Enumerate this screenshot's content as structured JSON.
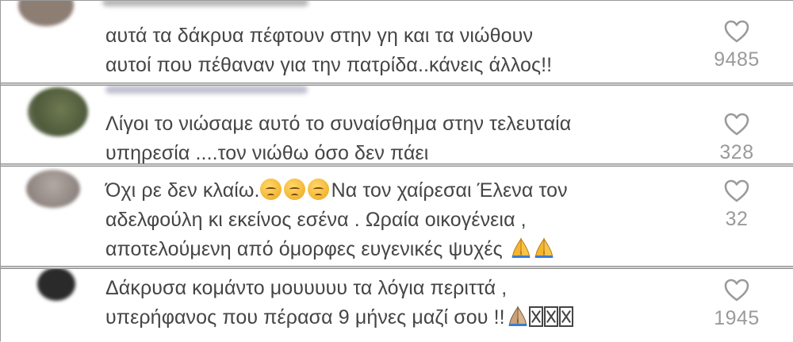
{
  "comments": [
    {
      "lines": [
        "αυτά τα δάκρυα πέφτουν στην γη και τα νιώθουν",
        "αυτοί που πέθαναν για την πατρίδα..κάνεις άλλος!!"
      ],
      "likes": "9485"
    },
    {
      "lines": [
        "Λίγοι το νιώσαμε αυτό το συναίσθημα στην τελευταία",
        "υπηρεσία ....τον νιώθω όσο δεν πάει"
      ],
      "likes": "328"
    },
    {
      "line1_start": "Όχι ρε δεν κλαίω.",
      "line1_end": "Να τον χαίρεσαι Έλενα τον",
      "emoji_1": "pensive-face",
      "lines_rest": [
        "αδελφούλη κι εκείνος εσένα . Ωραία οικογένεια ,",
        "αποτελούμενη από όμορφες ευγενικές ψυχές "
      ],
      "emoji_2": "folded-hands",
      "likes": "32"
    },
    {
      "line1": "Δάκρυσα κομάντο μουυυυυ τα λόγια περιττά ,",
      "line2": "υπερήφανος που πέρασα 9 μήνες μαζί σου !!",
      "emoji_3": "folded-hands",
      "missing_glyphs": "missing-glyph-boxes",
      "likes": "1945"
    }
  ],
  "colors": {
    "text": "#454545",
    "count": "#9a9a9a",
    "heart": "#9a9a9a",
    "separator": "#cfcfcf"
  }
}
